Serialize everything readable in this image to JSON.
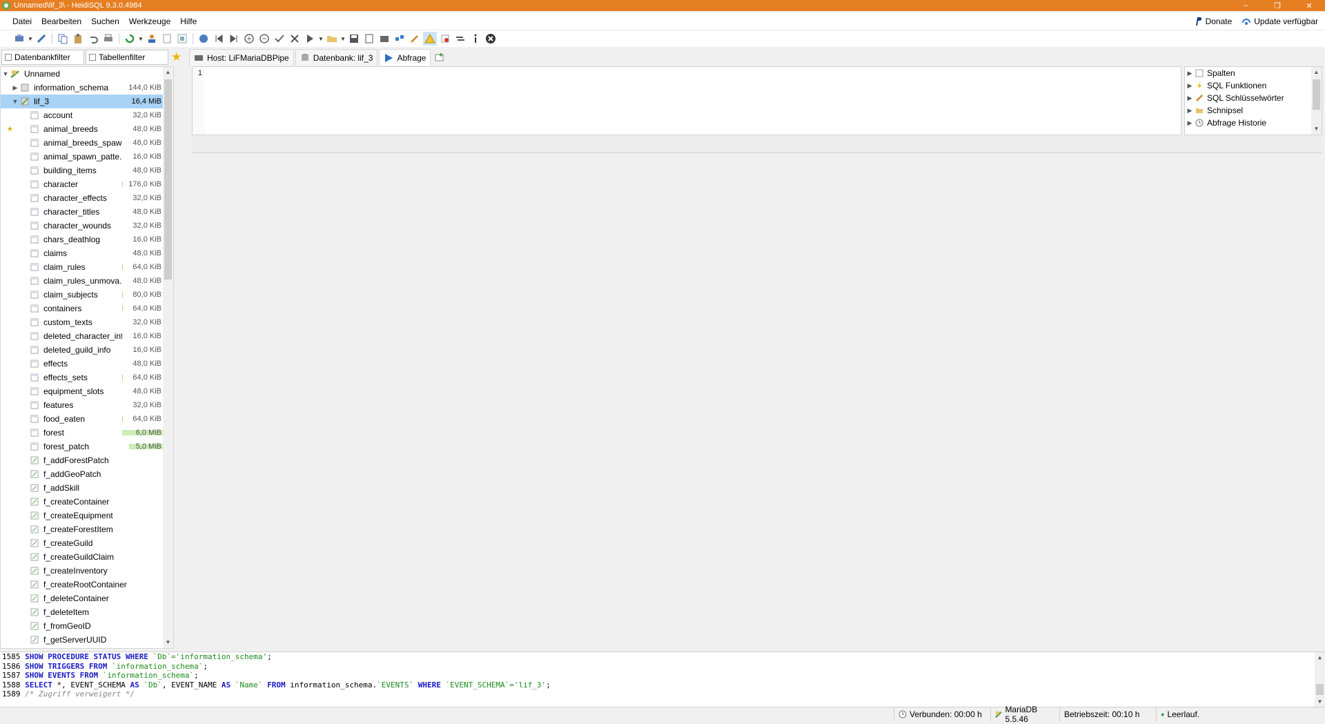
{
  "window": {
    "title": "Unnamed\\lif_3\\ - HeidiSQL 9.3.0.4984",
    "minimize": "–",
    "maximize": "❐",
    "close": "✕"
  },
  "menu": {
    "items": [
      "Datei",
      "Bearbeiten",
      "Suchen",
      "Werkzeuge",
      "Hilfe"
    ],
    "donate": "Donate",
    "update": "Update verfügbar"
  },
  "filters": {
    "db": "Datenbankfilter",
    "table": "Tabellenfilter"
  },
  "tabs": {
    "host": "Host: LiFMariaDBPipe",
    "database": "Datenbank: lif_3",
    "query": "Abfrage"
  },
  "tree": {
    "root": "Unnamed",
    "databases": [
      {
        "name": "information_schema",
        "size": "144,0 KiB"
      },
      {
        "name": "lif_3",
        "size": "16,4 MiB"
      }
    ],
    "tables": [
      {
        "name": "account",
        "size": "32,0 KiB"
      },
      {
        "name": "animal_breeds",
        "size": "48,0 KiB"
      },
      {
        "name": "animal_breeds_spaw...",
        "size": "48,0 KiB"
      },
      {
        "name": "animal_spawn_patte...",
        "size": "16,0 KiB"
      },
      {
        "name": "building_items",
        "size": "48,0 KiB"
      },
      {
        "name": "character",
        "size": "176,0 KiB"
      },
      {
        "name": "character_effects",
        "size": "32,0 KiB"
      },
      {
        "name": "character_titles",
        "size": "48,0 KiB"
      },
      {
        "name": "character_wounds",
        "size": "32,0 KiB"
      },
      {
        "name": "chars_deathlog",
        "size": "16,0 KiB"
      },
      {
        "name": "claims",
        "size": "48,0 KiB"
      },
      {
        "name": "claim_rules",
        "size": "64,0 KiB"
      },
      {
        "name": "claim_rules_unmova...",
        "size": "48,0 KiB"
      },
      {
        "name": "claim_subjects",
        "size": "80,0 KiB"
      },
      {
        "name": "containers",
        "size": "64,0 KiB"
      },
      {
        "name": "custom_texts",
        "size": "32,0 KiB"
      },
      {
        "name": "deleted_character_info",
        "size": "16,0 KiB"
      },
      {
        "name": "deleted_guild_info",
        "size": "16,0 KiB"
      },
      {
        "name": "effects",
        "size": "48,0 KiB"
      },
      {
        "name": "effects_sets",
        "size": "64,0 KiB"
      },
      {
        "name": "equipment_slots",
        "size": "48,0 KiB"
      },
      {
        "name": "features",
        "size": "32,0 KiB"
      },
      {
        "name": "food_eaten",
        "size": "64,0 KiB"
      },
      {
        "name": "forest",
        "size": "6,0 MiB"
      },
      {
        "name": "forest_patch",
        "size": "5,0 MiB"
      }
    ],
    "functions": [
      "f_addForestPatch",
      "f_addGeoPatch",
      "f_addSkill",
      "f_createContainer",
      "f_createEquipment",
      "f_createForestItem",
      "f_createGuild",
      "f_createGuildClaim",
      "f_createInventory",
      "f_createRootContainer",
      "f_deleteContainer",
      "f_deleteItem",
      "f_fromGeoID",
      "f_getServerUUID"
    ]
  },
  "editor": {
    "line": "1"
  },
  "helpers": [
    "Spalten",
    "SQL Funktionen",
    "SQL Schlüsselwörter",
    "Schnipsel",
    "Abfrage Historie"
  ],
  "log": [
    {
      "n": "1585",
      "parts": [
        [
          "kw",
          "SHOW PROCEDURE STATUS WHERE "
        ],
        [
          "str",
          "`Db`='information_schema'"
        ],
        [
          "",
          "; "
        ]
      ]
    },
    {
      "n": "1586",
      "parts": [
        [
          "kw",
          "SHOW TRIGGERS FROM "
        ],
        [
          "str",
          "`information_schema`"
        ],
        [
          "",
          ";"
        ]
      ]
    },
    {
      "n": "1587",
      "parts": [
        [
          "kw",
          "SHOW EVENTS FROM "
        ],
        [
          "str",
          "`information_schema`"
        ],
        [
          "",
          ";"
        ]
      ]
    },
    {
      "n": "1588",
      "parts": [
        [
          "kw",
          "SELECT "
        ],
        [
          "",
          "*, EVENT_SCHEMA "
        ],
        [
          "kw",
          "AS "
        ],
        [
          "str",
          "`Db`"
        ],
        [
          "",
          ", EVENT_NAME "
        ],
        [
          "kw",
          "AS "
        ],
        [
          "str",
          "`Name`"
        ],
        [
          "",
          ""
        ],
        [
          "kw",
          " FROM "
        ],
        [
          "",
          "information_schema."
        ],
        [
          "str",
          "`EVENTS`"
        ],
        [
          "kw",
          " WHERE "
        ],
        [
          "str",
          "`EVENT_SCHEMA`='lif_3'"
        ],
        [
          "",
          ";"
        ]
      ]
    },
    {
      "n": "1589",
      "parts": [
        [
          "cmt",
          "/* Zugriff verweigert */"
        ]
      ]
    }
  ],
  "status": {
    "connected": "Verbunden: 00:00 h",
    "server": "MariaDB 5.5.46",
    "uptime": "Betriebszeit: 00:10 h",
    "idle": "Leerlauf."
  }
}
